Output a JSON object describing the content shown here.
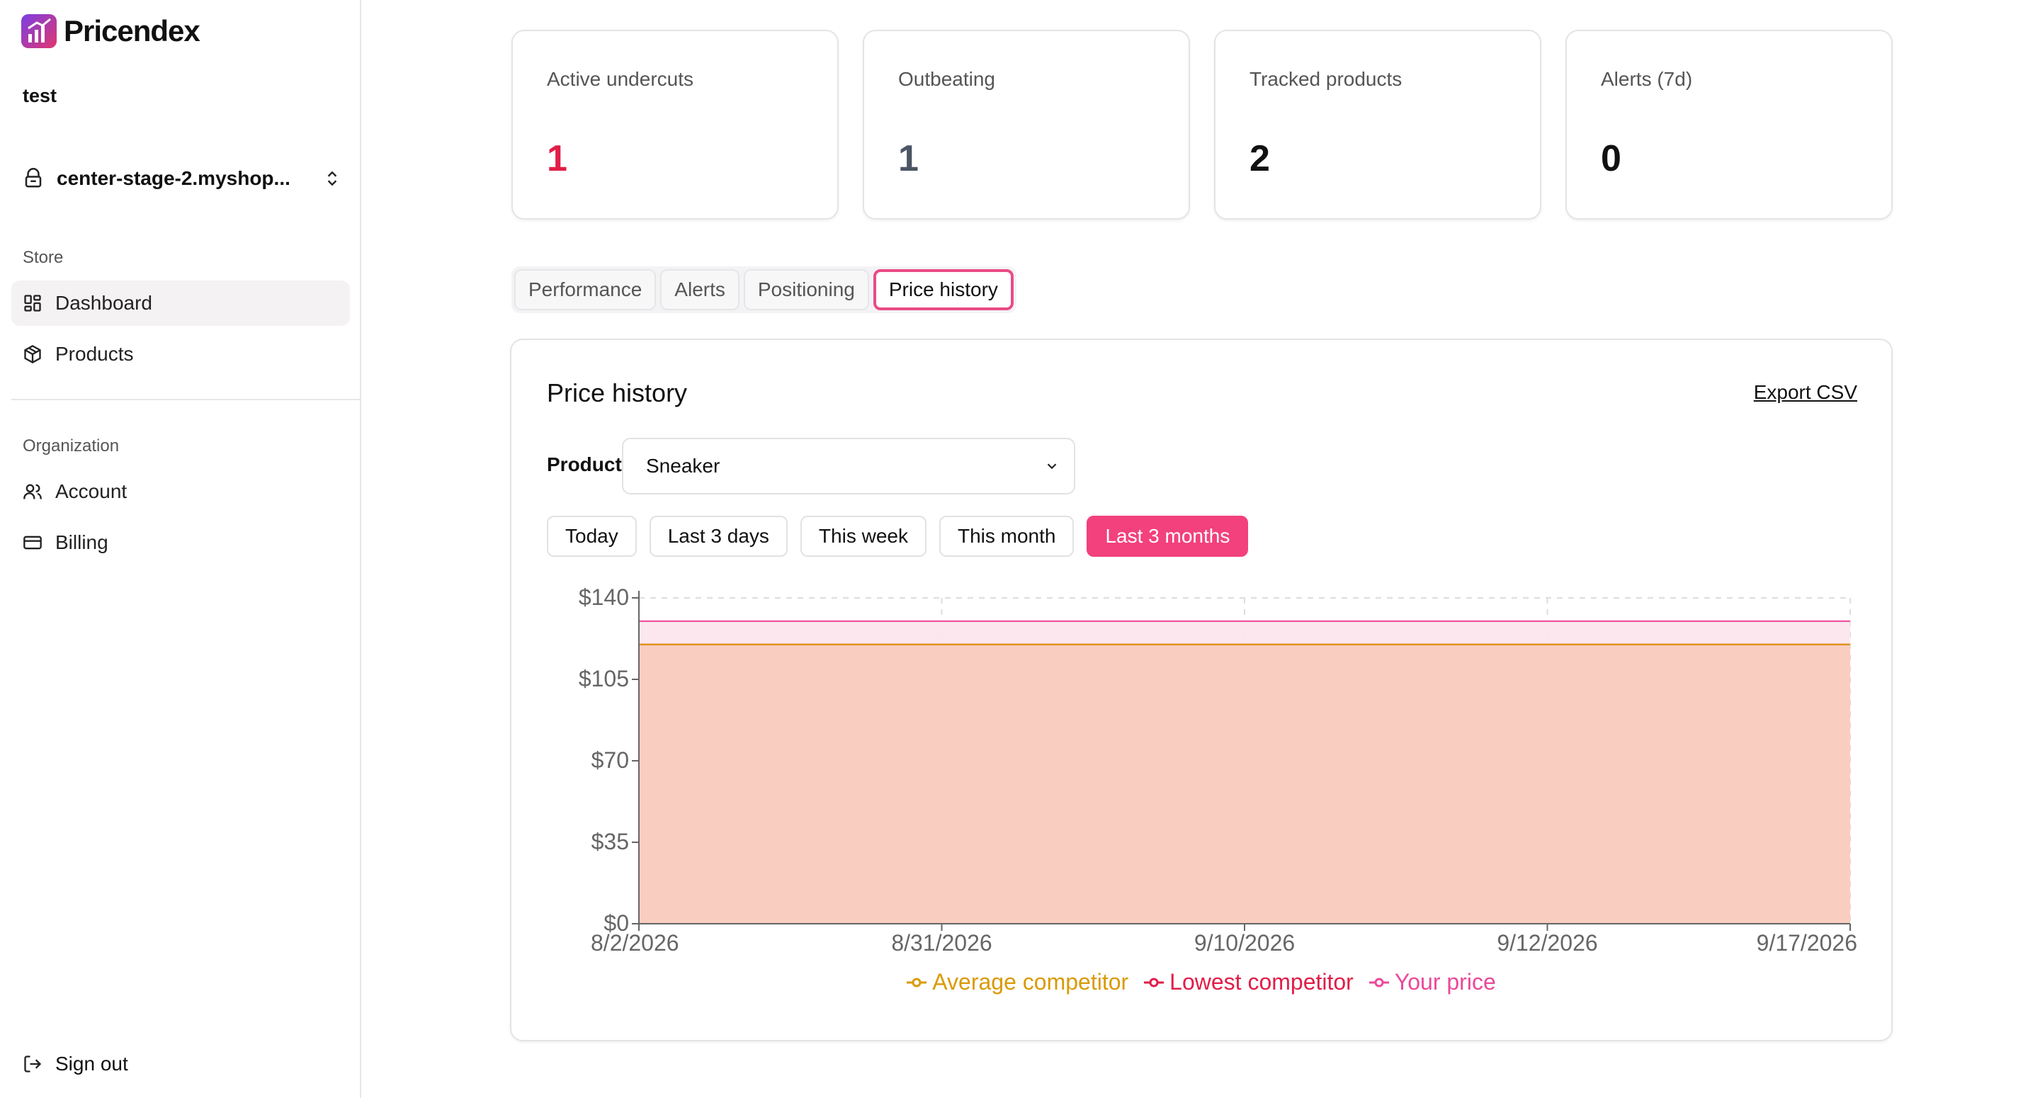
{
  "app": {
    "name": "Pricendex",
    "org": "test",
    "store": "center-stage-2.myshop..."
  },
  "sidebar": {
    "store_section": "Store",
    "store_items": [
      {
        "label": "Dashboard",
        "icon": "dashboard-icon"
      },
      {
        "label": "Products",
        "icon": "package-icon"
      }
    ],
    "org_section": "Organization",
    "org_items": [
      {
        "label": "Account",
        "icon": "users-icon"
      },
      {
        "label": "Billing",
        "icon": "credit-card-icon"
      }
    ],
    "sign_out": "Sign out"
  },
  "stats": [
    {
      "label": "Active undercuts",
      "value": "1",
      "color": "#e11d48"
    },
    {
      "label": "Outbeating",
      "value": "1",
      "color": "#4b5563"
    },
    {
      "label": "Tracked products",
      "value": "2",
      "color": "#111111"
    },
    {
      "label": "Alerts (7d)",
      "value": "0",
      "color": "#111111"
    }
  ],
  "tabs": [
    {
      "label": "Performance"
    },
    {
      "label": "Alerts"
    },
    {
      "label": "Positioning"
    },
    {
      "label": "Price history",
      "active": true
    }
  ],
  "panel": {
    "title": "Price history",
    "export_label": "Export CSV",
    "product_label": "Product",
    "product_value": "Sneaker",
    "ranges": [
      "Today",
      "Last 3 days",
      "This week",
      "This month",
      "Last 3 months"
    ],
    "active_range": "Last 3 months"
  },
  "chart_data": {
    "type": "area",
    "x": [
      "8/2/2026",
      "8/31/2026",
      "9/10/2026",
      "9/12/2026",
      "9/17/2026"
    ],
    "y_ticks": [
      "$0",
      "$35",
      "$70",
      "$105",
      "$140"
    ],
    "ylim": [
      0,
      140
    ],
    "grid": true,
    "legend_position": "bottom",
    "series": [
      {
        "name": "Average competitor",
        "values": [
          120,
          120,
          120,
          120,
          120
        ],
        "color": "#d99a06"
      },
      {
        "name": "Lowest competitor",
        "values": [
          120,
          120,
          120,
          120,
          120
        ],
        "color": "#e11d48"
      },
      {
        "name": "Your price",
        "values": [
          130,
          130,
          130,
          130,
          130
        ],
        "color": "#ec4899"
      }
    ]
  }
}
